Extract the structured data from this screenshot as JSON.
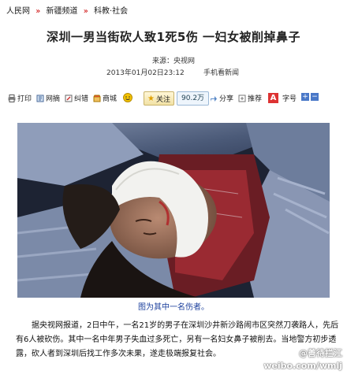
{
  "breadcrumb": {
    "items": [
      "人民网",
      "新疆频道",
      "科教·社会"
    ],
    "separator": "»"
  },
  "article": {
    "title": "深圳一男当街砍人致1死5伤 一妇女被削掉鼻子",
    "source": "来源：央视网",
    "date": "2013年01月02日23:12",
    "mobile_link": "手机看新闻",
    "caption": "图为其中一名伤者。",
    "body": "据央视网报道，2日中午，一名21岁的男子在深圳沙井新沙路闹市区突然刀袭路人，先后有6人被砍伤。其中一名中年男子失血过多死亡，另有一名妇女鼻子被削去。当地警方初步透露，砍人者到深圳后找工作多次未果，遂走极端报复社会。"
  },
  "toolbar": {
    "print": "打印",
    "netpick": "网摘",
    "error": "纠错",
    "mall": "商城",
    "follow": "关注",
    "follow_count": "90.2万",
    "share": "分享",
    "recommend": "推荐",
    "font": "字号"
  },
  "watermark": {
    "line1": "@善待拦江",
    "line2": "weibo.com/wmlj"
  },
  "colors": {
    "link_red": "#cc0000",
    "caption_blue": "#1b3f9c"
  }
}
